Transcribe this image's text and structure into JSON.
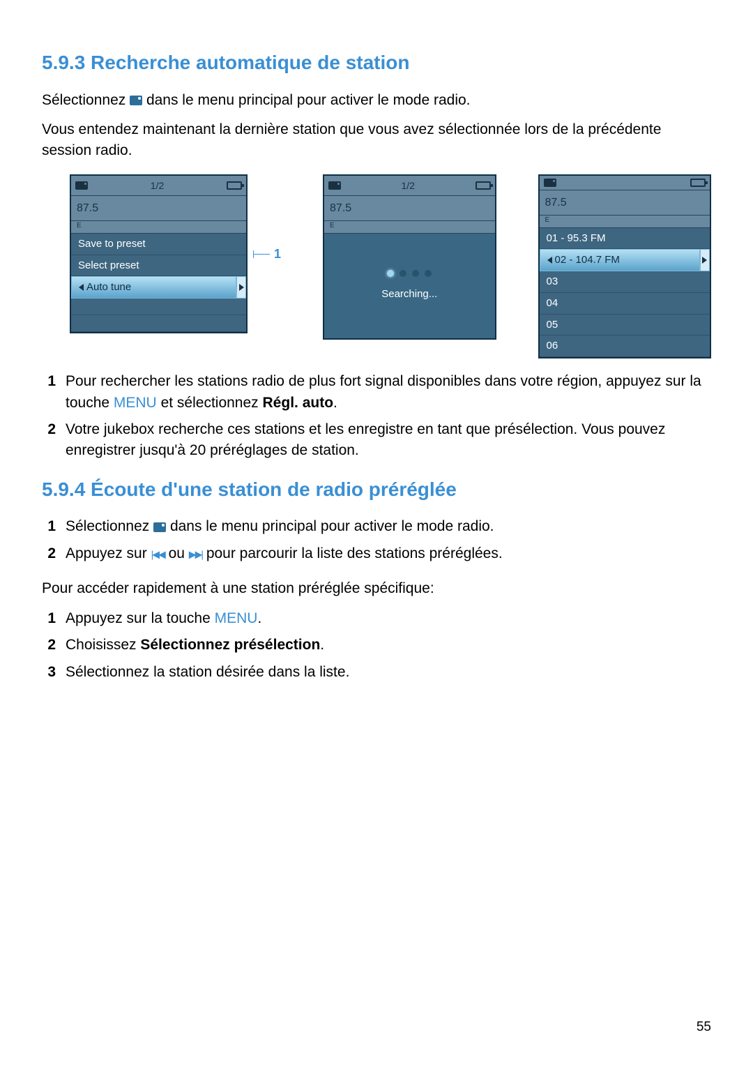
{
  "section1": {
    "heading": "5.9.3 Recherche automatique de station",
    "p1_a": "Sélectionnez ",
    "p1_b": " dans le menu principal pour activer le mode radio.",
    "p2": "Vous entendez maintenant la dernière station que vous avez sélectionnée lors de la précédente session radio.",
    "step1_a": "Pour rechercher les stations radio de plus fort signal disponibles dans votre région, appuyez sur la touche ",
    "step1_menu": "MENU",
    "step1_b": " et sélectionnez ",
    "step1_bold": "Régl. auto",
    "step1_c": ".",
    "step2": "Votre jukebox recherche ces stations et les enregistre en tant que présélection. Vous pouvez enregistrer jusqu'à 20 préréglages de station."
  },
  "section2": {
    "heading": "5.9.4 Écoute d'une station de radio préréglée",
    "s1_a": "Sélectionnez ",
    "s1_b": " dans le menu principal pour activer le mode radio.",
    "s2_a": "Appuyez sur ",
    "s2_mid": " ou ",
    "s2_b": " pour parcourir la liste des stations préréglées.",
    "p3": "Pour accéder rapidement à une station préréglée spécifique:",
    "q1_a": "Appuyez sur la touche ",
    "q1_menu": "MENU",
    "q1_b": ".",
    "q2_a": "Choisissez ",
    "q2_bold": "Sélectionnez présélection",
    "q2_b": ".",
    "q3": "Sélectionnez la station désirée dans la liste."
  },
  "screens": {
    "count": "1/2",
    "freq": "87.5",
    "e": "E",
    "screen1": {
      "item1": "Save to preset",
      "item2": "Select preset",
      "item3": "Auto tune",
      "callout": "1"
    },
    "screen2": {
      "searching": "Searching..."
    },
    "screen3": {
      "r1": "01 - 95.3 FM",
      "r2": "02 - 104.7 FM",
      "r3": "03",
      "r4": "04",
      "r5": "05",
      "r6": "06"
    }
  },
  "icons": {
    "prev": "|◀◀",
    "next": "▶▶|"
  },
  "page": "55"
}
